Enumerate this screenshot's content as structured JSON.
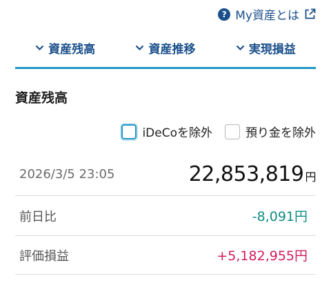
{
  "header": {
    "help_icon_glyph": "?",
    "help_label": "My資産とは"
  },
  "tabs": [
    {
      "label": "資産残高"
    },
    {
      "label": "資産推移"
    },
    {
      "label": "実現損益"
    }
  ],
  "section": {
    "title": "資産残高"
  },
  "filters": {
    "ideco_label": "iDeCoを除外",
    "deposit_label": "預り金を除外",
    "ideco_checked": false,
    "deposit_checked": false
  },
  "balance": {
    "timestamp": "2026/3/5 23:05",
    "amount": "22,853,819",
    "currency": "円"
  },
  "day_change": {
    "label": "前日比",
    "value": "-8,091円"
  },
  "unrealized_gain": {
    "label": "評価損益",
    "value": "+5,182,955円"
  },
  "colors": {
    "accent": "#1e96c8",
    "link": "#1a4f8b",
    "negative": "#0f8a82",
    "positive": "#d11a5e"
  }
}
